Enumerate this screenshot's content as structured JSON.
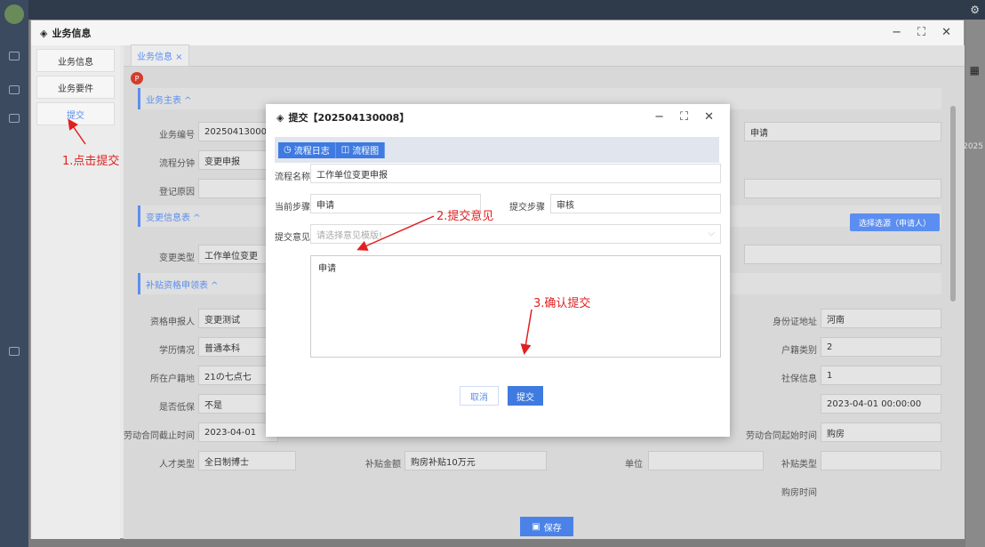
{
  "background": {
    "year_fragment": "2025"
  },
  "window": {
    "title": "业务信息",
    "minimize": "−",
    "maximize": "⛶",
    "close": "✕"
  },
  "sidebar": {
    "items": [
      {
        "label": "业务信息"
      },
      {
        "label": "业务要件"
      },
      {
        "label": "提交"
      }
    ]
  },
  "tabs": [
    {
      "label": "业务信息 ×"
    }
  ],
  "badge": "P",
  "sections": {
    "main_table": "业务主表 ^",
    "change_table": "变更信息表 ^",
    "subsidy_table": "补贴资格申领表 ^"
  },
  "fields": {
    "biz_no_label": "业务编号",
    "biz_no_value": "202504130008",
    "flow_branch_label": "流程分钟",
    "flow_branch_value": "变更申报",
    "reg_reason_label": "登记原因",
    "right_apply_value": "申请",
    "change_type_label": "变更类型",
    "change_type_value": "工作单位变更",
    "pick_button": "选择选源（申请人）",
    "applicant_label": "资格申报人",
    "applicant_value": "变更测试",
    "edu_label": "学历情况",
    "edu_value": "普通本科",
    "hukou_label": "所在户籍地",
    "hukou_value": "21の七点七",
    "lowincome_label": "是否低保",
    "lowincome_value": "不是",
    "contract_end_label": "劳动合同截止时间",
    "contract_end_value": "2023-04-01",
    "talent_label": "人才类型",
    "talent_value": "全日制博士",
    "subsidy_amount_label": "补贴金额",
    "subsidy_amount_value": "购房补贴10万元",
    "unit_label": "单位",
    "idaddr_label": "身份证地址",
    "idaddr_value": "河南",
    "hukou_type_label": "户籍类别",
    "hukou_type_value": "2",
    "social_label": "社保信息",
    "social_value": "1",
    "contract_start_label": "劳动合同起始时间",
    "contract_start_value": "2023-04-01 00:00:00",
    "subsidy_type_label": "补贴类型",
    "subsidy_type_value": "购房",
    "housing_time_label": "购房时间"
  },
  "save_button": "保存",
  "annotations": {
    "step1": "1.点击提交",
    "step2": "2.提交意见",
    "step3": "3.确认提交"
  },
  "dialog": {
    "title": "提交【202504130008】",
    "minimize": "−",
    "maximize": "⛶",
    "close": "✕",
    "flow_log_button": "流程日志",
    "flow_chart_button": "流程图",
    "flow_name_label": "流程名称",
    "flow_name_value": "工作单位变更申报",
    "current_step_label": "当前步骤",
    "current_step_value": "申请",
    "submit_step_label": "提交步骤",
    "submit_step_value": "审核",
    "opinion_label": "提交意见",
    "opinion_placeholder": "请选择意见模版!",
    "opinion_text": "申请",
    "cancel_button": "取消",
    "submit_button": "提交"
  },
  "colors": {
    "accent": "#3f7ae0",
    "annotation": "#e02020",
    "badge": "#d43c2c"
  }
}
